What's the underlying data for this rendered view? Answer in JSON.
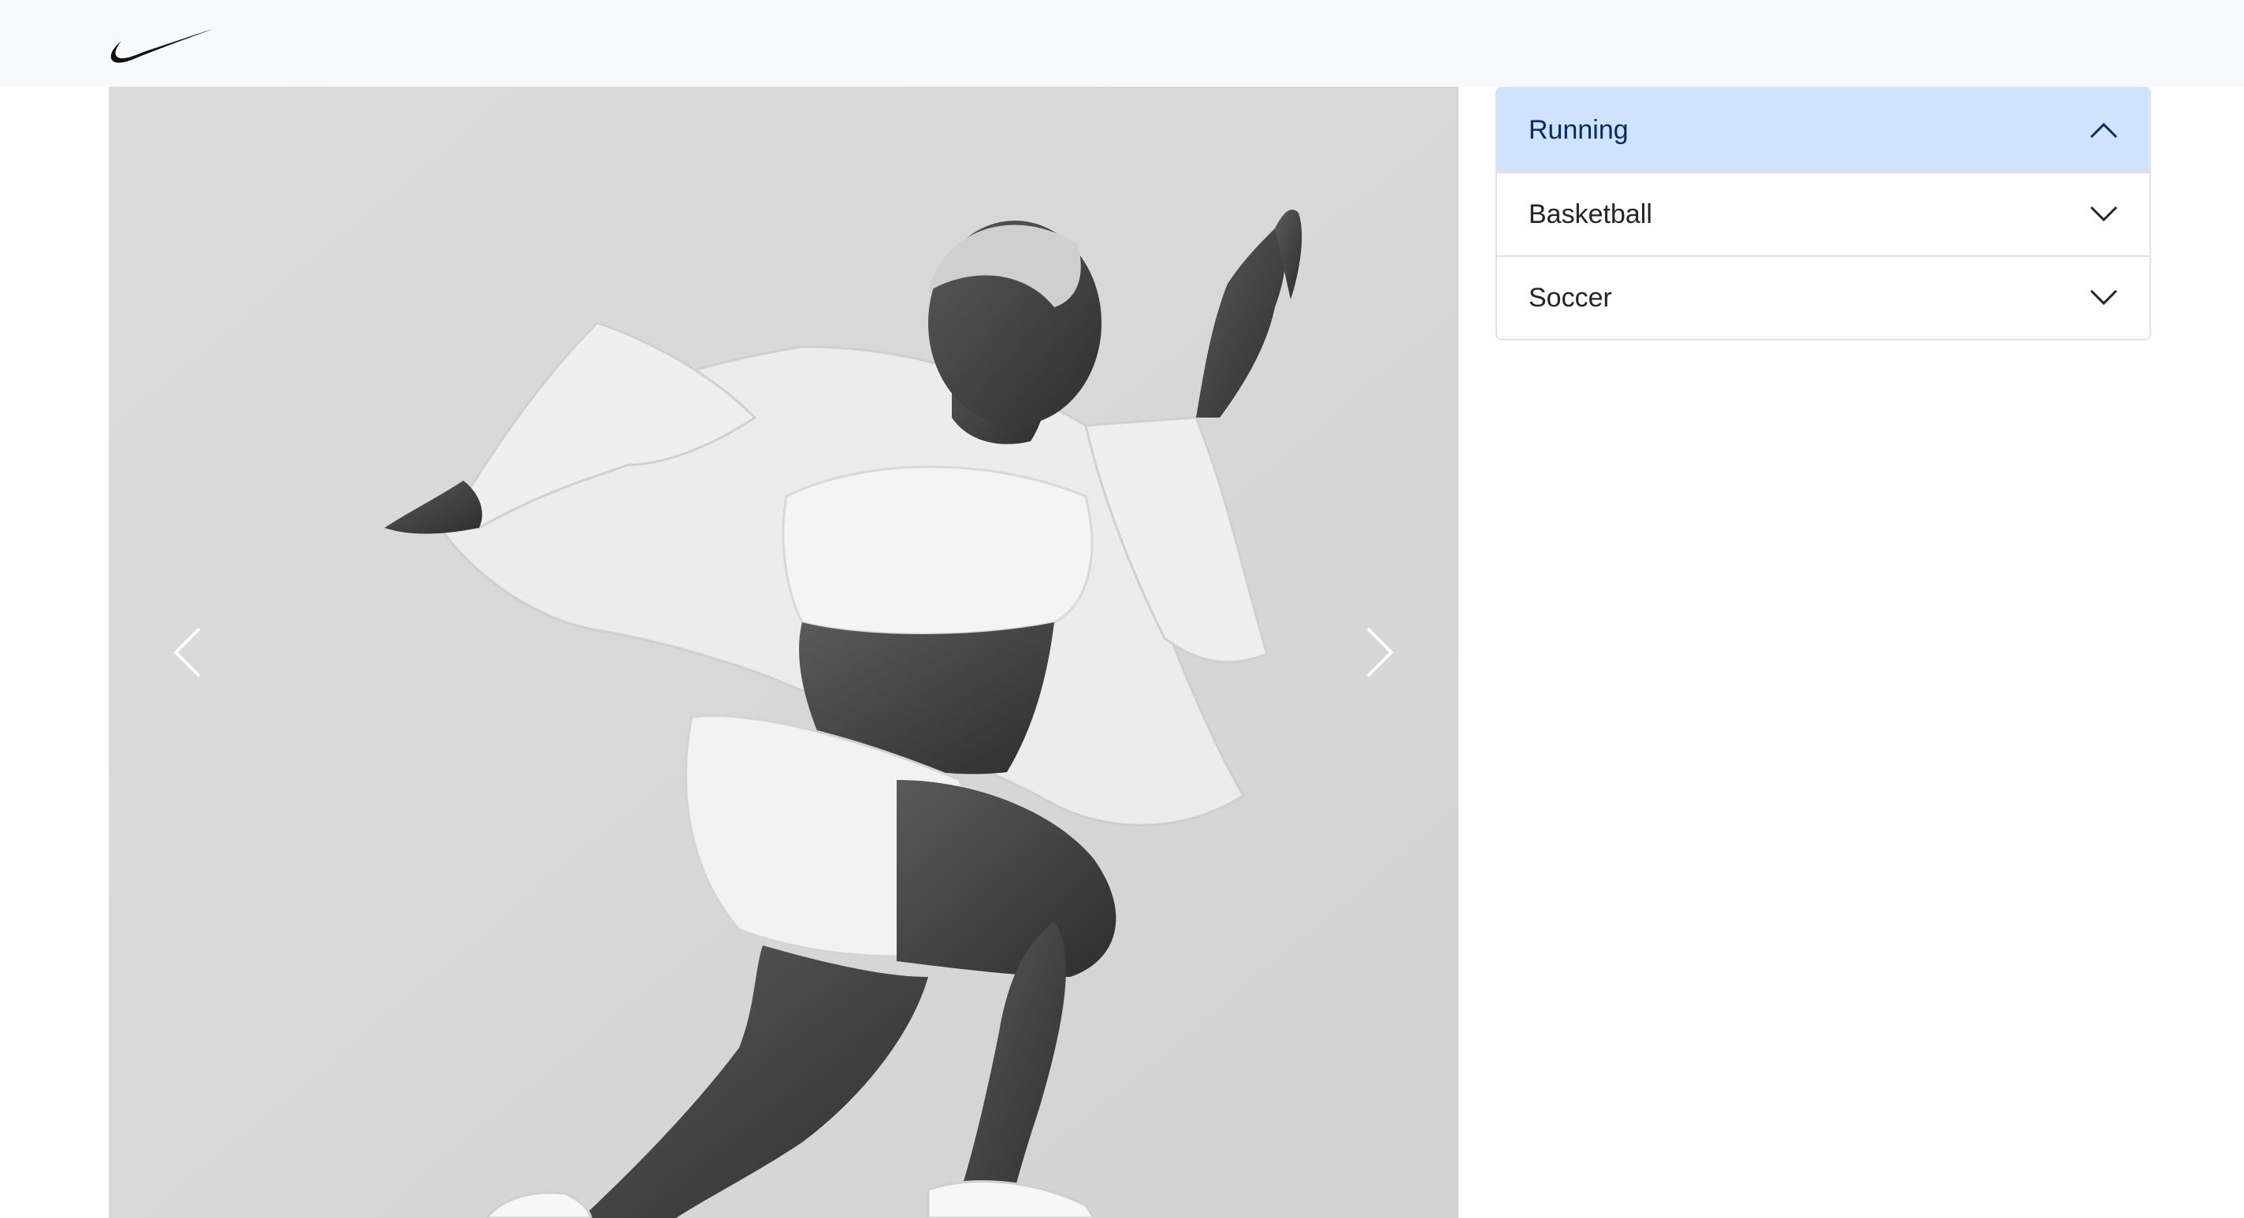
{
  "brand": {
    "logo": "nike-swoosh-icon"
  },
  "carousel": {
    "image_alt": "Athlete sprinting in white running jacket and shorts, black-and-white photo",
    "prev_icon": "chevron-left-icon",
    "next_icon": "chevron-right-icon"
  },
  "accordion": {
    "items": [
      {
        "label": "Running",
        "expanded": true,
        "icon": "chevron-up-icon"
      },
      {
        "label": "Basketball",
        "expanded": false,
        "icon": "chevron-down-icon"
      },
      {
        "label": "Soccer",
        "expanded": false,
        "icon": "chevron-down-icon"
      }
    ]
  },
  "colors": {
    "topbar_bg": "#f8f9fa",
    "active_item_bg": "#cfe2ff",
    "active_item_text": "#052c65",
    "border": "#dee2e6"
  }
}
